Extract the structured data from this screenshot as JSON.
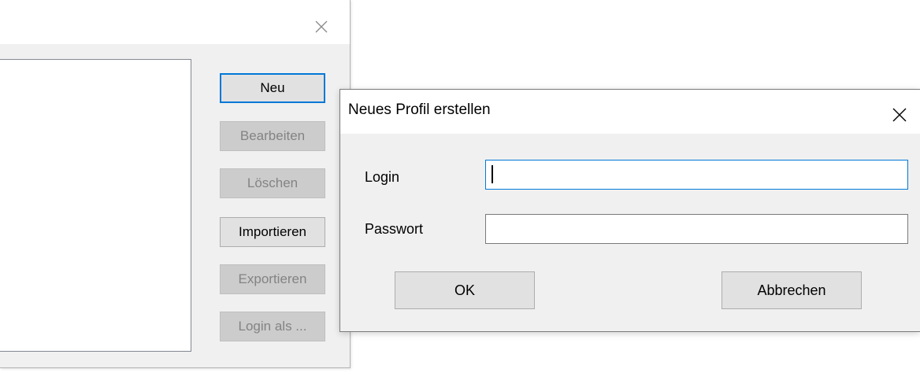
{
  "background_window": {
    "close_icon": "close-icon",
    "buttons": {
      "new": "Neu",
      "edit": "Bearbeiten",
      "delete": "Löschen",
      "import": "Importieren",
      "export": "Exportieren",
      "login_as": "Login als ..."
    }
  },
  "dialog": {
    "title": "Neues Profil erstellen",
    "close_icon": "close-icon",
    "login_label": "Login",
    "login_value": "",
    "password_label": "Passwort",
    "password_value": "",
    "ok_label": "OK",
    "cancel_label": "Abbrechen"
  },
  "colors": {
    "focus_accent": "#0078d7",
    "button_face": "#e1e1e1",
    "window_face": "#f0f0f0",
    "disabled_text": "#838383"
  }
}
